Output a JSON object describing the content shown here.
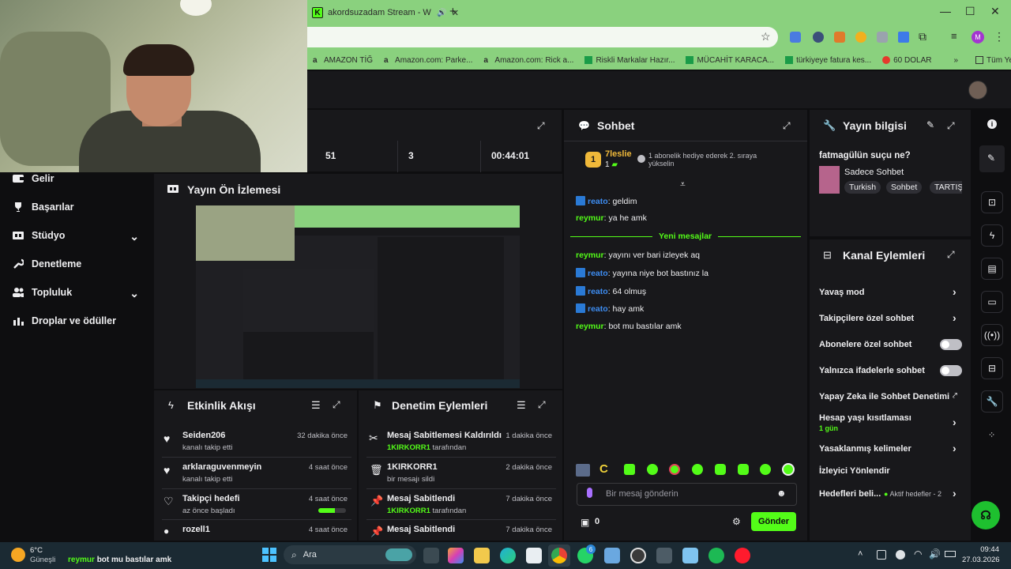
{
  "browser": {
    "tab_title": "akordsuzadam Stream - W",
    "bookmarks": [
      "AMAZON TİĞ",
      "Amazon.com: Parke...",
      "Amazon.com: Rick a...",
      "Riskli Markalar Hazır...",
      "MÜCAHİT KARACA...",
      "türkiyeye fatura kes...",
      "60 DOLAR"
    ],
    "bookmarks_more": "»",
    "bookmarks_folder": "Tüm Yer İşaretleri",
    "profile_initial": "M"
  },
  "nav": {
    "items": [
      {
        "label": "Gelir"
      },
      {
        "label": "Başarılar"
      },
      {
        "label": "Stüdyo"
      },
      {
        "label": "Denetleme"
      },
      {
        "label": "Topluluk"
      },
      {
        "label": "Droplar ve ödüller"
      }
    ]
  },
  "stats": {
    "values": [
      "51",
      "3",
      "00:44:01"
    ]
  },
  "preview": {
    "title": "Yayın Ön İzlemesi"
  },
  "activity": {
    "title": "Etkinlik Akışı",
    "items": [
      {
        "name": "Seiden206",
        "sub": "kanalı takip etti",
        "time": "32 dakika önce"
      },
      {
        "name": "arklaraguvenmeyin",
        "sub": "kanalı takip etti",
        "time": "4 saat önce"
      },
      {
        "name": "Takipçi hedefi",
        "sub": "az önce başladı",
        "time": "4 saat önce",
        "progress": 0.6
      },
      {
        "name": "rozell1",
        "sub": "",
        "time": "4 saat önce"
      }
    ]
  },
  "moderation": {
    "title": "Denetim Eylemleri",
    "items": [
      {
        "name": "Mesaj Sabitlemesi Kaldırıldı",
        "user": "1KIRKORR1",
        "suffix": "tarafından",
        "time": "1 dakika önce"
      },
      {
        "name": "1KIRKORR1",
        "user": "",
        "suffix": "bir mesajı sildi",
        "time": "2 dakika önce"
      },
      {
        "name": "Mesaj Sabitlendi",
        "user": "1KIRKORR1",
        "suffix": "tarafından",
        "time": "7 dakika önce"
      },
      {
        "name": "Mesaj Sabitlendi",
        "user": "",
        "suffix": "",
        "time": "7 dakika önce"
      }
    ]
  },
  "chat": {
    "title": "Sohbet",
    "top_gifter": {
      "rank": "1",
      "name": "7leslie",
      "count": "1"
    },
    "gift_text": "1 abonelik hediye ederek 2. sıraya yükselin",
    "messages_before": [
      {
        "user": "reato",
        "text": ": geldim",
        "badge": true
      },
      {
        "user": "reymur",
        "text": ": ya he amk",
        "badge": false
      }
    ],
    "divider": "Yeni mesajlar",
    "messages_after": [
      {
        "user": "reymur",
        "text": ": yayını ver bari izleyek aq",
        "badge": false
      },
      {
        "user": "reato",
        "text": ": yayına niye bot bastınız la",
        "badge": true
      },
      {
        "user": "reato",
        "text": ": 64 olmuş",
        "badge": true
      },
      {
        "user": "reato",
        "text": ": hay amk",
        "badge": true
      },
      {
        "user": "reymur",
        "text": ": bot mu bastılar amk",
        "badge": false
      }
    ],
    "placeholder": "Bir mesaj gönderin",
    "points": "0",
    "send_label": "Gönder"
  },
  "stream_info": {
    "title": "Yayın bilgisi",
    "stream_title": "fatmagülün suçu ne?",
    "category": "Sadece Sohbet",
    "tags": [
      "Turkish",
      "Sohbet",
      "TARTIŞ"
    ]
  },
  "channel_actions": {
    "title": "Kanal Eylemleri",
    "items": [
      {
        "label": "Yavaş mod",
        "control": "chevron"
      },
      {
        "label": "Takipçilere özel sohbet",
        "control": "chevron"
      },
      {
        "label": "Abonelere özel sohbet",
        "control": "toggle"
      },
      {
        "label": "Yalnızca ifadelerle sohbet",
        "control": "toggle"
      },
      {
        "label": "Yapay Zeka ile Sohbet Denetimi",
        "control": "external"
      },
      {
        "label": "Hesap yaşı kısıtlaması",
        "sub": "1 gün",
        "control": "chevron"
      },
      {
        "label": "Yasaklanmış kelimeler",
        "control": "chevron"
      },
      {
        "label": "İzleyici Yönlendir",
        "control": "none"
      },
      {
        "label": "Hedefleri beli...",
        "extra": "Aktif hedefler - 2",
        "control": "chevron"
      }
    ]
  },
  "taskbar": {
    "weather_temp": "6°C",
    "weather_desc": "Güneşli",
    "notif_user": "reymur",
    "notif_text": "bot mu bastılar amk",
    "search_label": "Ara",
    "whatsapp_badge": "6",
    "time": "09:44",
    "date": "27.03.2026"
  },
  "colors": {
    "accent": "#53fc18",
    "panel": "#18181b",
    "bg": "#0e0e10",
    "browser_frame": "#8ad17e"
  }
}
